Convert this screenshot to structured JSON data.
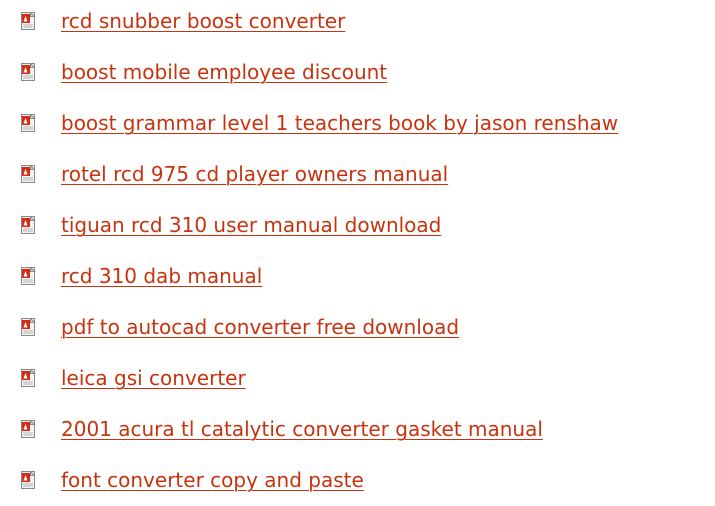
{
  "icon": "pdf-file-icon",
  "link_color": "#c8330f",
  "links": [
    {
      "label": "rcd snubber boost converter"
    },
    {
      "label": "boost mobile employee discount"
    },
    {
      "label": "boost grammar level 1 teachers book by jason renshaw"
    },
    {
      "label": "rotel rcd 975 cd player owners manual"
    },
    {
      "label": "tiguan rcd 310 user manual download"
    },
    {
      "label": "rcd 310 dab manual"
    },
    {
      "label": "pdf to autocad converter free download"
    },
    {
      "label": "leica gsi converter"
    },
    {
      "label": "2001 acura tl catalytic converter gasket manual"
    },
    {
      "label": "font converter copy and paste"
    }
  ]
}
